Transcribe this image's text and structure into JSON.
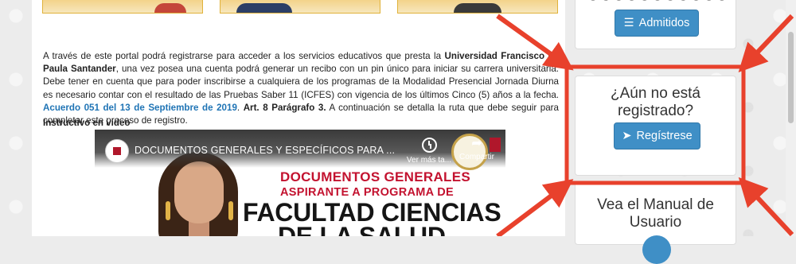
{
  "intro": {
    "part1": "A través de este portal podrá registrarse para acceder a los servicios educativos que presta la ",
    "university": "Universidad Francisco de Paula Santander",
    "part2": ", una vez posea una cuenta podrá generar un recibo con un pin único para iniciar su carrera universitaria. Debe tener en cuenta que para poder inscribirse a cualquiera de los programas de la Modalidad Presencial Jornada Diurna es necesario contar con el resultado de las Pruebas Saber 11 (ICFES) con vigencia de los últimos Cinco (5) años a la fecha. ",
    "agreement_link": "Acuerdo 051 del 13 de Septiembre de 2019",
    "article": "Art. 8 Parágrafo 3.",
    "part3": " A continuación se detalla la ruta que debe seguir para completar este proceso de registro."
  },
  "video_section": {
    "label": "Instructivo en video",
    "title": "DOCUMENTOS GENERALES Y ESPECÍFICOS PARA ...",
    "watch_later": "Ver más ta...",
    "share": "Compartir",
    "thumb_line1": "DOCUMENTOS GENERALES",
    "thumb_line2": "ASPIRANTE A PROGRAMA DE",
    "thumb_line3": "FACULTAD CIENCIAS",
    "thumb_line4": "DE LA SALUD"
  },
  "sidebar": {
    "admitidos_button": "Admitidos",
    "registro_title_line1": "¿Aún no está",
    "registro_title_line2": "registrado?",
    "registro_button": "Regístrese",
    "manual_title_line1": "Vea el Manual de",
    "manual_title_line2": "Usuario"
  },
  "colors": {
    "accent_button": "#3f8fc6",
    "highlight_annotation": "#e8412c",
    "link": "#1f74b5",
    "video_red": "#c3122f"
  },
  "icons": {
    "admitidos": "list-icon",
    "registro": "paper-plane-icon",
    "watch_later": "clock-icon",
    "share": "share-arrow-icon"
  }
}
